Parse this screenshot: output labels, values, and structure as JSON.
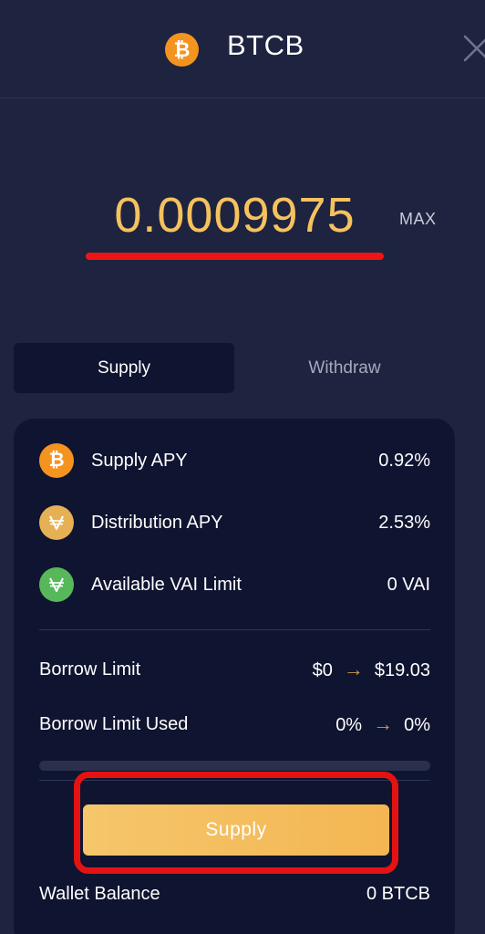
{
  "header": {
    "coin_symbol": "₿",
    "title": "BTCB",
    "close_icon": "close-icon"
  },
  "amount": {
    "value": "0.0009975",
    "max_label": "MAX"
  },
  "tabs": [
    {
      "label": "Supply",
      "active": true
    },
    {
      "label": "Withdraw",
      "active": false
    }
  ],
  "info": {
    "supply_apy": {
      "label": "Supply APY",
      "value": "0.92%",
      "icon": "bitcoin-icon"
    },
    "distribution_apy": {
      "label": "Distribution APY",
      "value": "2.53%",
      "icon": "venus-icon"
    },
    "vai_limit": {
      "label": "Available VAI Limit",
      "value": "0 VAI",
      "icon": "vai-icon"
    },
    "borrow_limit": {
      "label": "Borrow Limit",
      "from": "$0",
      "arrow": "→",
      "to": "$19.03"
    },
    "borrow_limit_used": {
      "label": "Borrow Limit Used",
      "from": "0%",
      "arrow": "→",
      "to": "0%",
      "progress": 0
    }
  },
  "action": {
    "button_label": "Supply"
  },
  "wallet": {
    "label": "Wallet Balance",
    "value": "0 BTCB"
  },
  "colors": {
    "background": "#1e2340",
    "card": "#0f1430",
    "accent": "#f6c25e",
    "highlight": "#e51212",
    "bitcoin": "#f5931f",
    "vai": "#57b85a"
  }
}
